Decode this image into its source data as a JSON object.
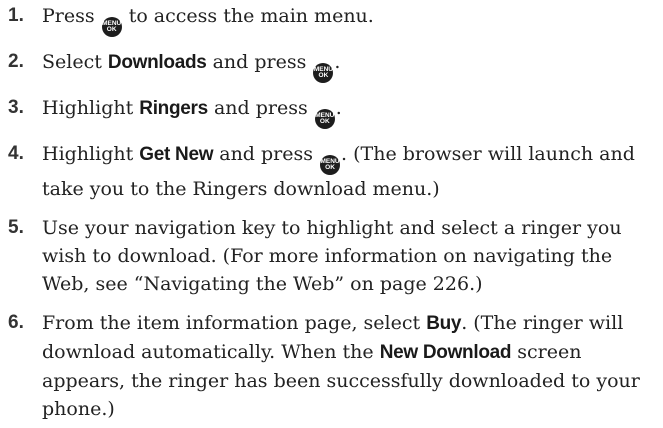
{
  "menu_icon": {
    "line1": "MENU",
    "line2": "OK"
  },
  "steps": [
    {
      "num": "1.",
      "t1": "Press ",
      "t2": " to access the main menu."
    },
    {
      "num": "2.",
      "t1": "Select ",
      "b1": "Downloads",
      "t2": " and press ",
      "t3": "."
    },
    {
      "num": "3.",
      "t1": "Highlight ",
      "b1": "Ringers",
      "t2": " and press ",
      "t3": "."
    },
    {
      "num": "4.",
      "t1": "Highlight ",
      "b1": "Get New",
      "t2": " and press ",
      "t3": ". (The browser will launch and take you to the Ringers download menu.)"
    },
    {
      "num": "5.",
      "t1": "Use your navigation key to highlight and select a ringer you wish to download. (For more information on navigating the Web, see “Navigating the Web” on page 226.)"
    },
    {
      "num": "6.",
      "t1": "From the item information page, select ",
      "b1": "Buy",
      "t2": ". (The ringer will download automatically. When the ",
      "b2": "New Download",
      "t3": " screen appears, the ringer has been successfully downloaded to your phone.)"
    }
  ]
}
